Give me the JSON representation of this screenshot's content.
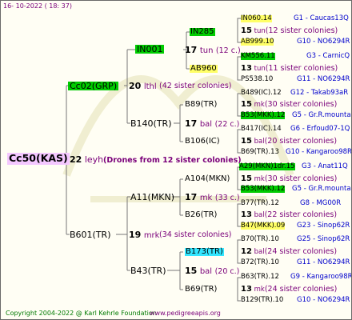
{
  "date": "16- 10-2022 ( 18: 37)",
  "root": {
    "name": "Cc50(KAS)",
    "num": "22",
    "colony": "leyh",
    "sisters": "(Drones from 12 sister colonies)"
  },
  "l1": [
    {
      "name": "Cc02(GRP)",
      "num": "20",
      "colony": "lthl",
      "sisters": "(42 sister colonies)"
    },
    {
      "name": "B601(TR)",
      "num": "19",
      "colony": "mrk",
      "sisters": "(34 sister colonies)"
    }
  ],
  "l2": [
    {
      "name": "IN001",
      "num": "17",
      "colony": "tun",
      "sisters": "(12 c.)"
    },
    {
      "name": "B140(TR)",
      "num": "17",
      "colony": "bal",
      "sisters": "(22 c.)"
    },
    {
      "name": "A11(MKN)",
      "num": "17",
      "colony": "mk",
      "sisters": "(33 c.)"
    },
    {
      "name": "B43(TR)",
      "num": "15",
      "colony": "bal",
      "sisters": "(20 c.)"
    }
  ],
  "l3": [
    {
      "name": "IN285",
      "num": "15",
      "colony": "tun",
      "sisters": "(12 sister colonies)"
    },
    {
      "name": "AB960",
      "num": "13",
      "colony": "tun",
      "sisters": "(11 sister colonies)"
    },
    {
      "name": "B89(TR)",
      "num": "15",
      "colony": "mk",
      "sisters": "(30 sister colonies)"
    },
    {
      "name": "B106(IC)",
      "num": "15",
      "colony": "bal",
      "sisters": "(20 sister colonies)"
    },
    {
      "name": "A104(MKN)",
      "num": "15",
      "colony": "mk",
      "sisters": "(30 sister colonies)"
    },
    {
      "name": "B26(TR)",
      "num": "13",
      "colony": "bal",
      "sisters": "(22 sister colonies)"
    },
    {
      "name": "B173(TR)",
      "num": "12",
      "colony": "bal",
      "sisters": "(24 sister colonies)"
    },
    {
      "name": "B69(TR)",
      "num": "13",
      "colony": "mk",
      "sisters": "(24 sister colonies)"
    }
  ],
  "l4": [
    {
      "name": "IN060.14",
      "src": "G1 - Caucas13Q"
    },
    {
      "name": "AB999.10",
      "src": "G10 - NO6294R"
    },
    {
      "name": "KM556.11",
      "src": "G3 - CarnicQ"
    },
    {
      "name": "PS538.10",
      "src": "G11 - NO6294R"
    },
    {
      "name": "B489(IC).12",
      "src": "G12 - Takab93aR"
    },
    {
      "name": "B53(MKK).12",
      "src": "G5 - Gr.R.mounta"
    },
    {
      "name": "B417(IC).14",
      "src": "G6 - Erfoud07-1Q"
    },
    {
      "name": "B69(TR).13",
      "src": "G10 - Kangaroo98R"
    },
    {
      "name": "A29(MKN)1dr.15",
      "src": "G3 - Anat11Q"
    },
    {
      "name": "B53(MKK).12",
      "src": "G5 - Gr.R.mounta"
    },
    {
      "name": "B77(TR).12",
      "src": "G8 - MG00R"
    },
    {
      "name": "B47(MKK).09",
      "src": "G23 - Sinop62R"
    },
    {
      "name": "B70(TR).10",
      "src": "G25 - Sinop62R"
    },
    {
      "name": "B72(TR).10",
      "src": "G11 - NO6294R"
    },
    {
      "name": "B63(TR).12",
      "src": "G9 - Kangaroo98R"
    },
    {
      "name": "B129(TR).10",
      "src": "G10 - NO6294R"
    }
  ],
  "footer": "Copyright 2004-2022 @ Karl Kehrle Foundation",
  "site": "www.pedigreeapis.org"
}
